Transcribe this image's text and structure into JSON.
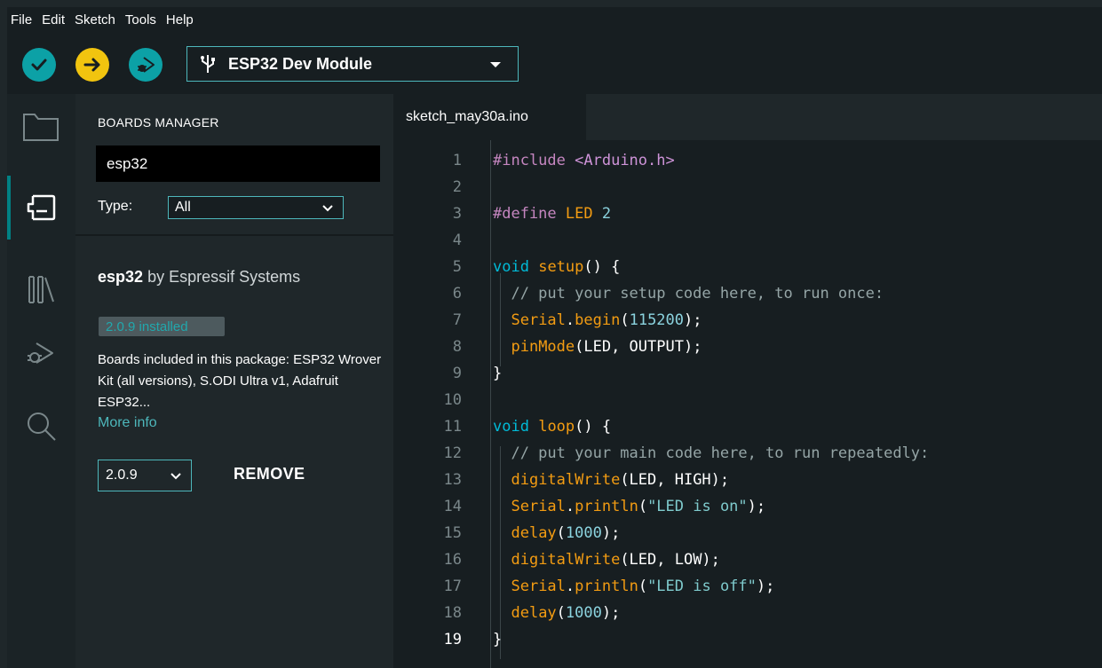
{
  "menu": [
    "File",
    "Edit",
    "Sketch",
    "Tools",
    "Help"
  ],
  "toolbar": {
    "verify_icon": "check-icon",
    "upload_icon": "arrow-right-icon",
    "debug_icon": "debug-icon",
    "board_icon": "usb-icon",
    "board_label": "ESP32 Dev Module",
    "accent": "#008184",
    "upload_color": "#f1c40f"
  },
  "activity": [
    "folder-icon",
    "boards-icon",
    "library-icon",
    "debug-icon",
    "search-icon"
  ],
  "boards_manager": {
    "title": "BOARDS MANAGER",
    "search_value": "esp32",
    "type_label": "Type:",
    "type_value": "All",
    "package": {
      "name": "esp32",
      "by": "by",
      "author": "Espressif Systems",
      "installed_badge": "2.0.9 installed",
      "description": "Boards included in this package: ESP32 Wrover Kit (all versions), S.ODI Ultra v1, Adafruit ESP32...",
      "more_info": "More info",
      "version": "2.0.9",
      "remove": "REMOVE"
    }
  },
  "editor": {
    "tab": "sketch_may30a.ino",
    "active_line": 19,
    "lines": [
      "#include <Arduino.h>",
      "",
      "#define LED 2",
      "",
      "void setup() {",
      "  // put your setup code here, to run once:",
      "  Serial.begin(115200);",
      "  pinMode(LED, OUTPUT);",
      "}",
      "",
      "void loop() {",
      "  // put your main code here, to run repeatedly:",
      "  digitalWrite(LED, HIGH);",
      "  Serial.println(\"LED is on\");",
      "  delay(1000);",
      "  digitalWrite(LED, LOW);",
      "  Serial.println(\"LED is off\");",
      "  delay(1000);",
      "}"
    ]
  }
}
